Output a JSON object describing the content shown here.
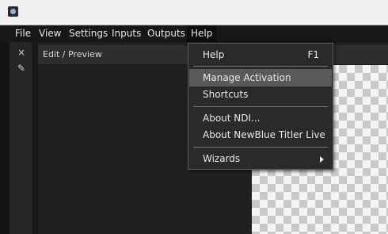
{
  "menubar": {
    "items": [
      {
        "label": "File"
      },
      {
        "label": "View"
      },
      {
        "label": "Settings"
      },
      {
        "label": "Inputs"
      },
      {
        "label": "Outputs"
      },
      {
        "label": "Help"
      }
    ]
  },
  "toolbar": {
    "close_icon": "×",
    "pin_icon": "✎"
  },
  "panel": {
    "title": "Edit / Preview"
  },
  "help_menu": {
    "help": {
      "label": "Help",
      "shortcut": "F1"
    },
    "manage_activation": "Manage Activation",
    "shortcuts": "Shortcuts",
    "about_ndi": "About NDI...",
    "about_app": "About NewBlue Titler Live",
    "wizards": "Wizards"
  },
  "colors": {
    "menubar_bg": "#171717",
    "menu_highlight": "#5a5a5a",
    "panel_bg": "#262626"
  }
}
